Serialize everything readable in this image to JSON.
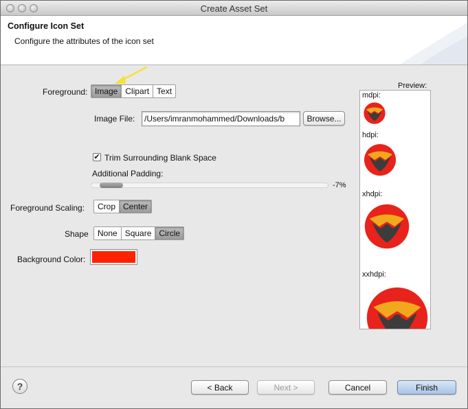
{
  "window": {
    "title": "Create Asset Set"
  },
  "header": {
    "title": "Configure Icon Set",
    "description": "Configure the attributes of the icon set"
  },
  "foreground": {
    "label": "Foreground:",
    "options": [
      "Image",
      "Clipart",
      "Text"
    ],
    "selected": "Image"
  },
  "image_file": {
    "label": "Image File:",
    "value": "/Users/imranmohammed/Downloads/b",
    "browse_label": "Browse..."
  },
  "trim": {
    "label": "Trim Surrounding Blank Space",
    "checked": true,
    "check_glyph": "✔"
  },
  "padding": {
    "label": "Additional Padding:",
    "value_text": "-7%",
    "fraction": 0.1
  },
  "scaling": {
    "label": "Foreground Scaling:",
    "options": [
      "Crop",
      "Center"
    ],
    "selected": "Center"
  },
  "shape": {
    "label": "Shape",
    "options": [
      "None",
      "Square",
      "Circle"
    ],
    "selected": "Circle"
  },
  "background_color": {
    "label": "Background Color:",
    "value": "#ff2200"
  },
  "preview": {
    "title": "Preview:",
    "densities": [
      "mdpi:",
      "hdpi:",
      "xhdpi:",
      "xxhdpi:"
    ]
  },
  "footer": {
    "help_glyph": "?",
    "back_label": "< Back",
    "next_label": "Next >",
    "cancel_label": "Cancel",
    "finish_label": "Finish"
  },
  "colors": {
    "icon_red": "#e8231c",
    "icon_gold": "#f0a91c",
    "icon_dark": "#3c3c3c",
    "arrow_yellow": "#f2e23a"
  },
  "icons": {
    "window_controls": "traffic-light-icon",
    "help": "help-icon",
    "annotation_arrow": "arrow-icon",
    "preview_icon": "phoenix-icon"
  }
}
